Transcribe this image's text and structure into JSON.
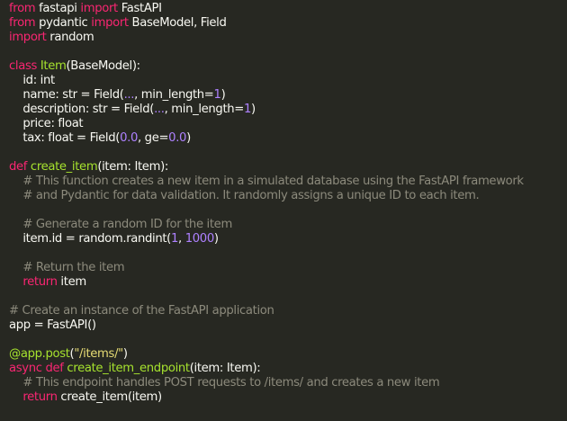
{
  "colors": {
    "background": "#272822",
    "text": "#f8f8f2",
    "keyword": "#f92672",
    "name": "#a6e22e",
    "number": "#ae81ff",
    "string": "#e6db74",
    "comment": "#8c8a7c"
  },
  "code_lines": [
    [
      {
        "t": "kw",
        "v": "from"
      },
      {
        "t": "txt",
        "v": " fastapi "
      },
      {
        "t": "kw",
        "v": "import"
      },
      {
        "t": "txt",
        "v": " FastAPI"
      }
    ],
    [
      {
        "t": "kw",
        "v": "from"
      },
      {
        "t": "txt",
        "v": " pydantic "
      },
      {
        "t": "kw",
        "v": "import"
      },
      {
        "t": "txt",
        "v": " BaseModel, Field"
      }
    ],
    [
      {
        "t": "kw",
        "v": "import"
      },
      {
        "t": "txt",
        "v": " random"
      }
    ],
    [],
    [
      {
        "t": "kw",
        "v": "class"
      },
      {
        "t": "txt",
        "v": " "
      },
      {
        "t": "cls",
        "v": "Item"
      },
      {
        "t": "txt",
        "v": "(BaseModel):"
      }
    ],
    [
      {
        "t": "txt",
        "v": "    id: int"
      }
    ],
    [
      {
        "t": "txt",
        "v": "    name: str = Field("
      },
      {
        "t": "num",
        "v": "..."
      },
      {
        "t": "txt",
        "v": ", min_length="
      },
      {
        "t": "num",
        "v": "1"
      },
      {
        "t": "txt",
        "v": ")"
      }
    ],
    [
      {
        "t": "txt",
        "v": "    description: str = Field("
      },
      {
        "t": "num",
        "v": "..."
      },
      {
        "t": "txt",
        "v": ", min_length="
      },
      {
        "t": "num",
        "v": "1"
      },
      {
        "t": "txt",
        "v": ")"
      }
    ],
    [
      {
        "t": "txt",
        "v": "    price: float"
      }
    ],
    [
      {
        "t": "txt",
        "v": "    tax: float = Field("
      },
      {
        "t": "num",
        "v": "0.0"
      },
      {
        "t": "txt",
        "v": ", ge="
      },
      {
        "t": "num",
        "v": "0.0"
      },
      {
        "t": "txt",
        "v": ")"
      }
    ],
    [],
    [
      {
        "t": "kw",
        "v": "def"
      },
      {
        "t": "txt",
        "v": " "
      },
      {
        "t": "fn",
        "v": "create_item"
      },
      {
        "t": "txt",
        "v": "(item: Item):"
      }
    ],
    [
      {
        "t": "cmt",
        "v": "    # This function creates a new item in a simulated database using the FastAPI framework"
      }
    ],
    [
      {
        "t": "cmt",
        "v": "    # and Pydantic for data validation. It randomly assigns a unique ID to each item."
      }
    ],
    [],
    [
      {
        "t": "cmt",
        "v": "    # Generate a random ID for the item"
      }
    ],
    [
      {
        "t": "txt",
        "v": "    item.id = random.randint("
      },
      {
        "t": "num",
        "v": "1"
      },
      {
        "t": "txt",
        "v": ", "
      },
      {
        "t": "num",
        "v": "1000"
      },
      {
        "t": "txt",
        "v": ")"
      }
    ],
    [],
    [
      {
        "t": "cmt",
        "v": "    # Return the item"
      }
    ],
    [
      {
        "t": "kw",
        "v": "    return"
      },
      {
        "t": "txt",
        "v": " item"
      }
    ],
    [],
    [
      {
        "t": "cmt",
        "v": "# Create an instance of the FastAPI application"
      }
    ],
    [
      {
        "t": "txt",
        "v": "app = FastAPI()"
      }
    ],
    [],
    [
      {
        "t": "fn",
        "v": "@app.post"
      },
      {
        "t": "txt",
        "v": "("
      },
      {
        "t": "str",
        "v": "\"/items/\""
      },
      {
        "t": "txt",
        "v": ")"
      }
    ],
    [
      {
        "t": "kw",
        "v": "async"
      },
      {
        "t": "txt",
        "v": " "
      },
      {
        "t": "kw",
        "v": "def"
      },
      {
        "t": "txt",
        "v": " "
      },
      {
        "t": "fn",
        "v": "create_item_endpoint"
      },
      {
        "t": "txt",
        "v": "(item: Item):"
      }
    ],
    [
      {
        "t": "cmt",
        "v": "    # This endpoint handles POST requests to /items/ and creates a new item"
      }
    ],
    [
      {
        "t": "kw",
        "v": "    return"
      },
      {
        "t": "txt",
        "v": " create_item(item)"
      }
    ]
  ]
}
